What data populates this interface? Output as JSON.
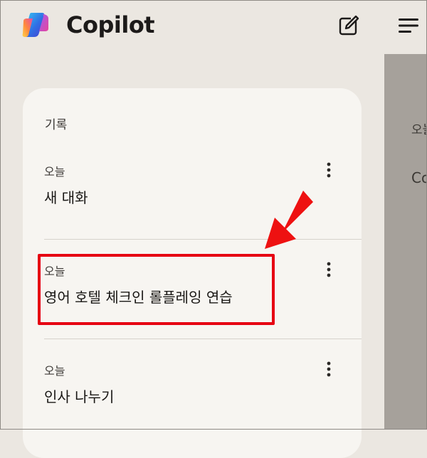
{
  "header": {
    "app_title": "Copilot"
  },
  "history": {
    "section_title": "기록",
    "items": [
      {
        "date": "오늘",
        "title": "새 대화"
      },
      {
        "date": "오늘",
        "title": "영어 호텔 체크인 롤플레잉 연습"
      },
      {
        "date": "오늘",
        "title": "인사 나누기"
      }
    ]
  },
  "main_peek": {
    "line1": "오늘",
    "line2": "Co"
  },
  "icons": {
    "logo": "copilot-logo",
    "new_chat": "compose-icon",
    "more": "more-vertical-icon",
    "menu": "hamburger-menu-icon"
  },
  "colors": {
    "sidebar_bg": "#ebe7e1",
    "panel_bg": "#f7f5f1",
    "overlay_bg": "#a6a19b",
    "annotation_red": "#e60012"
  }
}
